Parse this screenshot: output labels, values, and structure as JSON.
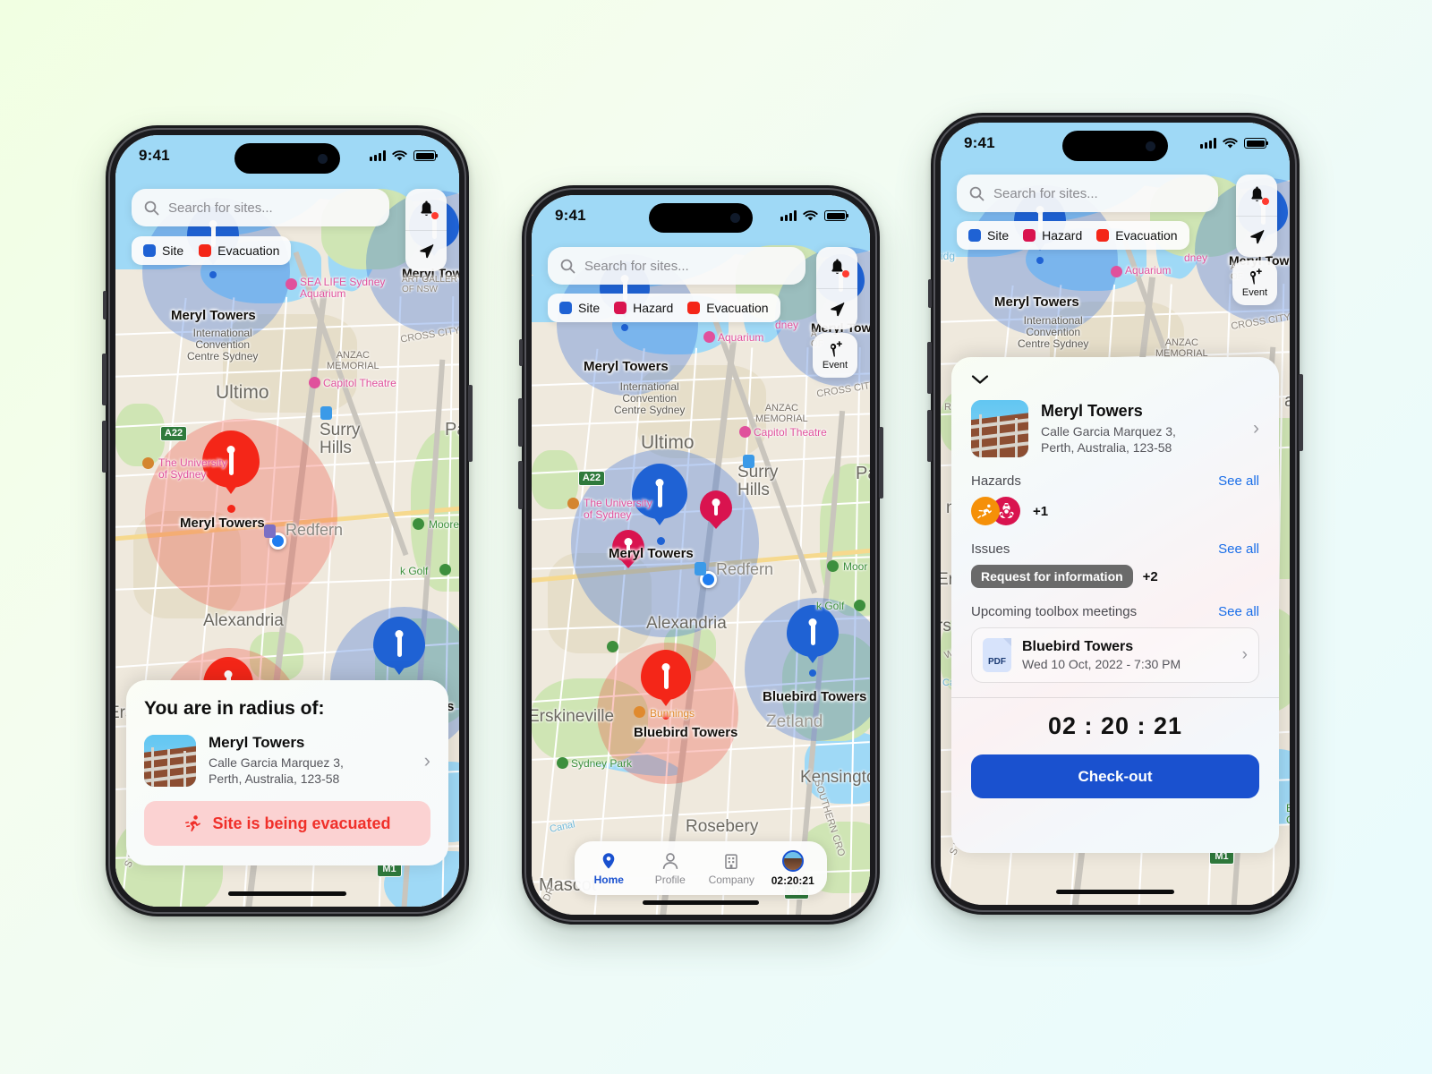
{
  "background": {
    "from": "#f1ffe2",
    "to": "#e9fbfd"
  },
  "colors": {
    "site": "#1f62d4",
    "hazard": "#d9134f",
    "evacuation": "#f42618",
    "accent_blue": "#1a51cf",
    "link_blue": "#1a6ee8",
    "evac_text": "#f0302a",
    "evac_bg": "#fbd2d2",
    "chip_bg": "#6a6a6a"
  },
  "status_bar": {
    "time": "9:41",
    "signal_icon": "cellular-bars-icon",
    "wifi_icon": "wifi-icon",
    "battery_icon": "battery-icon"
  },
  "search": {
    "placeholder": "Search for sites...",
    "icon": "search-icon"
  },
  "controls": {
    "notifications": {
      "icon": "bell-icon",
      "badge": true
    },
    "locate": {
      "icon": "navigation-arrow-icon"
    },
    "event": {
      "icon": "add-event-pin-icon",
      "label": "Event"
    }
  },
  "legend_full": [
    {
      "label": "Site",
      "color": "#1f62d4"
    },
    {
      "label": "Hazard",
      "color": "#d9134f"
    },
    {
      "label": "Evacuation",
      "color": "#f42618"
    }
  ],
  "legend_short": [
    {
      "label": "Site",
      "color": "#1f62d4"
    },
    {
      "label": "Evacuation",
      "color": "#f42618"
    }
  ],
  "map_labels": {
    "sites": [
      "Meryl Towers",
      "Bluebird Towers"
    ],
    "suburbs": [
      "Ultimo",
      "Surry Hills",
      "Redfern",
      "Alexandria",
      "Erskineville",
      "Zetland",
      "Kensington",
      "Rosebery",
      "Mascot",
      "Paddington"
    ],
    "pois": [
      "SEA LIFE Sydney Aquarium",
      "Capitol Theatre",
      "The University of Sydney",
      "International Convention Centre Sydney",
      "ANZAC MEMORIAL",
      "ART GALLERY OF NSW",
      "Moore Park",
      "Moore Park Golf",
      "Bunnings",
      "Sydney Park",
      "CROSS CITY TUNNEL",
      "SOUTHERN CROSS DR"
    ],
    "shields": [
      "A22",
      "M1"
    ]
  },
  "phone1": {
    "card": {
      "title": "You are in radius of:",
      "site_name": "Meryl Towers",
      "site_address_line1": "Calle Garcia Marquez 3,",
      "site_address_line2": "Perth, Australia, 123-58",
      "chevron": "›",
      "evacuation_label": "Site is being evacuated",
      "evacuation_icon": "running-person-icon"
    }
  },
  "phone2": {
    "tabs": [
      {
        "label": "Home",
        "icon": "map-pin-icon",
        "active": true
      },
      {
        "label": "Profile",
        "icon": "person-icon",
        "active": false
      },
      {
        "label": "Company",
        "icon": "building-icon",
        "active": false
      },
      {
        "label": "02:20:21",
        "icon": "avatar-timer-icon",
        "active": false
      }
    ]
  },
  "phone3": {
    "collapse_icon": "chevron-down-icon",
    "site_name": "Meryl Towers",
    "site_address_line1": "Calle Garcia Marquez 3,",
    "site_address_line2": "Perth, Australia, 123-58",
    "chevron": "›",
    "sections": {
      "hazards": {
        "label": "Hazards",
        "see_all": "See all",
        "items": [
          {
            "icon": "slip-fall-icon",
            "color": "#f59008"
          },
          {
            "icon": "biohazard-icon",
            "color": "#d9134f"
          }
        ],
        "more": "+1"
      },
      "issues": {
        "label": "Issues",
        "see_all": "See all",
        "chip": "Request for information",
        "more": "+2"
      },
      "meetings": {
        "label": "Upcoming toolbox meetings",
        "see_all": "See all",
        "items": [
          {
            "file_type": "PDF",
            "name": "Bluebird Towers",
            "date": "Wed 10 Oct, 2022 - 7:30 PM",
            "chevron": "›"
          }
        ]
      }
    },
    "timer": "02 : 20 : 21",
    "checkout_label": "Check-out"
  }
}
